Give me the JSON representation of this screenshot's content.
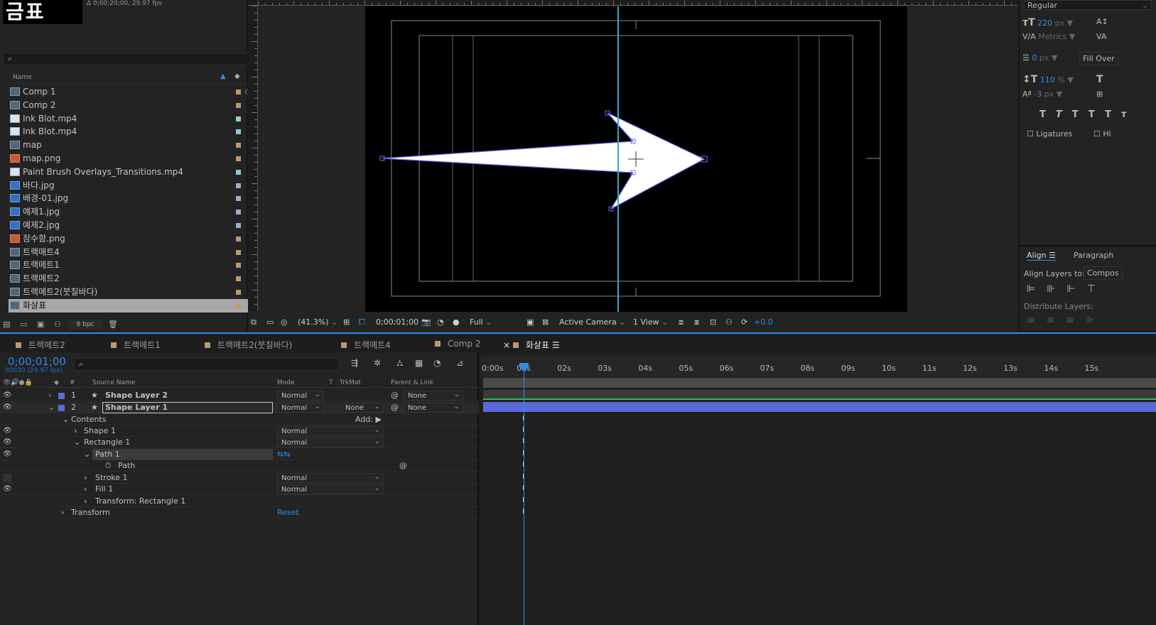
{
  "project": {
    "thumbnail_text": "금표",
    "info": "Δ 0;00;20;00, 29.97 fps",
    "search_placeholder": "",
    "col_name": "Name",
    "items": [
      {
        "name": "Comp 1",
        "type": "comp"
      },
      {
        "name": "Comp 2",
        "type": "comp"
      },
      {
        "name": "Ink Blot.mp4",
        "type": "vid"
      },
      {
        "name": "Ink Blot.mp4",
        "type": "vid"
      },
      {
        "name": "map",
        "type": "comp"
      },
      {
        "name": "map.png",
        "type": "img"
      },
      {
        "name": "Paint Brush Overlays_Transitions.mp4",
        "type": "vid"
      },
      {
        "name": "바다.jpg",
        "type": "jpg"
      },
      {
        "name": "배경-01.jpg",
        "type": "jpg"
      },
      {
        "name": "예제1.jpg",
        "type": "jpg"
      },
      {
        "name": "예제2.jpg",
        "type": "jpg"
      },
      {
        "name": "잠수함.png",
        "type": "img"
      },
      {
        "name": "트랙매트4",
        "type": "comp"
      },
      {
        "name": "트랙메트1",
        "type": "comp"
      },
      {
        "name": "트랙메트2",
        "type": "comp"
      },
      {
        "name": "트랙메트2(붓칠바다)",
        "type": "comp"
      },
      {
        "name": "화살표",
        "type": "comp"
      }
    ],
    "bpc": "8 bpc"
  },
  "viewer": {
    "zoom": "(41.3%)",
    "timecode": "0;00;01;00",
    "resolution": "Full",
    "camera": "Active Camera",
    "views": "1 View",
    "exposure": "+0.0"
  },
  "character": {
    "font_style": "Regular",
    "font_size": "220",
    "unit_px": "px",
    "tracking_method": "Metrics",
    "stroke_width": "0",
    "stroke_type": "Fill Over",
    "vertical_scale": "110",
    "percent": "%",
    "baseline_shift": "-3",
    "ligatures": "Ligatures",
    "hindi": "Hi"
  },
  "align": {
    "tab_align": "Align",
    "tab_paragraph": "Paragraph",
    "align_to_label": "Align Layers to:",
    "align_to_value": "Compos",
    "distribute": "Distribute Layers:"
  },
  "tabs": [
    {
      "label": "트랙메트2"
    },
    {
      "label": "트랙메트1"
    },
    {
      "label": "트랙메트2(붓칠바다)"
    },
    {
      "label": "트랙메트4"
    },
    {
      "label": "Comp 2"
    },
    {
      "label": "화살표"
    }
  ],
  "timeline": {
    "timecode": "0;00;01;00",
    "fps": "00030 (29.97 fps)",
    "col_source": "Source Name",
    "col_mode": "Mode",
    "col_t": "T",
    "col_trkmat": "TrkMat",
    "col_parent": "Parent & Link",
    "col_hash": "#",
    "layers": [
      {
        "num": "1",
        "name": "Shape Layer 2",
        "mode": "Normal",
        "parent": "None"
      },
      {
        "num": "2",
        "name": "Shape Layer 1",
        "mode": "Normal",
        "trkmat": "None",
        "parent": "None"
      }
    ],
    "contents": "Contents",
    "add": "Add:",
    "shape1": "Shape 1",
    "shape1_mode": "Normal",
    "rect1": "Rectangle 1",
    "rect1_mode": "Normal",
    "path1": "Path 1",
    "path": "Path",
    "stroke1": "Stroke 1",
    "stroke1_mode": "Normal",
    "fill1": "Fill 1",
    "fill1_mode": "Normal",
    "transform_rect": "Transform: Rectangle 1",
    "transform": "Transform",
    "reset": "Reset",
    "ticks": [
      "0:00s",
      "01s",
      "02s",
      "03s",
      "04s",
      "05s",
      "06s",
      "07s",
      "08s",
      "09s",
      "10s",
      "11s",
      "12s",
      "13s",
      "14s",
      "15s"
    ]
  }
}
